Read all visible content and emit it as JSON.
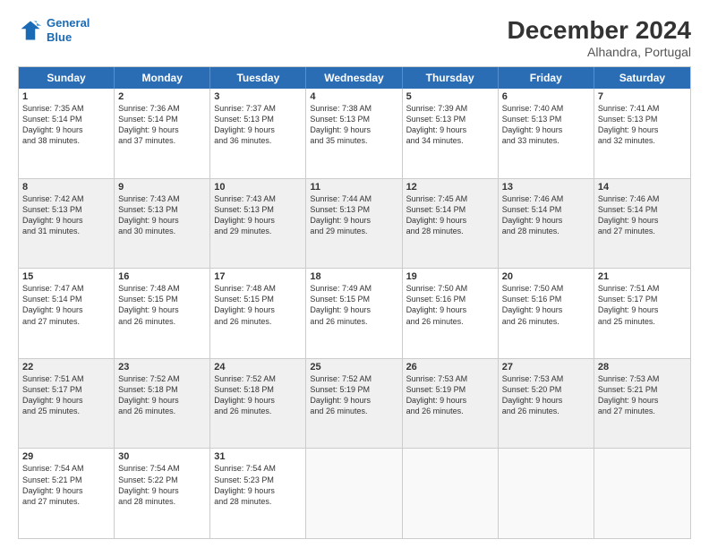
{
  "logo": {
    "line1": "General",
    "line2": "Blue"
  },
  "title": "December 2024",
  "subtitle": "Alhandra, Portugal",
  "header_days": [
    "Sunday",
    "Monday",
    "Tuesday",
    "Wednesday",
    "Thursday",
    "Friday",
    "Saturday"
  ],
  "rows": [
    [
      {
        "day": "1",
        "text": "Sunrise: 7:35 AM\nSunset: 5:14 PM\nDaylight: 9 hours\nand 38 minutes.",
        "empty": false,
        "shaded": false
      },
      {
        "day": "2",
        "text": "Sunrise: 7:36 AM\nSunset: 5:14 PM\nDaylight: 9 hours\nand 37 minutes.",
        "empty": false,
        "shaded": false
      },
      {
        "day": "3",
        "text": "Sunrise: 7:37 AM\nSunset: 5:13 PM\nDaylight: 9 hours\nand 36 minutes.",
        "empty": false,
        "shaded": false
      },
      {
        "day": "4",
        "text": "Sunrise: 7:38 AM\nSunset: 5:13 PM\nDaylight: 9 hours\nand 35 minutes.",
        "empty": false,
        "shaded": false
      },
      {
        "day": "5",
        "text": "Sunrise: 7:39 AM\nSunset: 5:13 PM\nDaylight: 9 hours\nand 34 minutes.",
        "empty": false,
        "shaded": false
      },
      {
        "day": "6",
        "text": "Sunrise: 7:40 AM\nSunset: 5:13 PM\nDaylight: 9 hours\nand 33 minutes.",
        "empty": false,
        "shaded": false
      },
      {
        "day": "7",
        "text": "Sunrise: 7:41 AM\nSunset: 5:13 PM\nDaylight: 9 hours\nand 32 minutes.",
        "empty": false,
        "shaded": false
      }
    ],
    [
      {
        "day": "8",
        "text": "Sunrise: 7:42 AM\nSunset: 5:13 PM\nDaylight: 9 hours\nand 31 minutes.",
        "empty": false,
        "shaded": true
      },
      {
        "day": "9",
        "text": "Sunrise: 7:43 AM\nSunset: 5:13 PM\nDaylight: 9 hours\nand 30 minutes.",
        "empty": false,
        "shaded": true
      },
      {
        "day": "10",
        "text": "Sunrise: 7:43 AM\nSunset: 5:13 PM\nDaylight: 9 hours\nand 29 minutes.",
        "empty": false,
        "shaded": true
      },
      {
        "day": "11",
        "text": "Sunrise: 7:44 AM\nSunset: 5:13 PM\nDaylight: 9 hours\nand 29 minutes.",
        "empty": false,
        "shaded": true
      },
      {
        "day": "12",
        "text": "Sunrise: 7:45 AM\nSunset: 5:14 PM\nDaylight: 9 hours\nand 28 minutes.",
        "empty": false,
        "shaded": true
      },
      {
        "day": "13",
        "text": "Sunrise: 7:46 AM\nSunset: 5:14 PM\nDaylight: 9 hours\nand 28 minutes.",
        "empty": false,
        "shaded": true
      },
      {
        "day": "14",
        "text": "Sunrise: 7:46 AM\nSunset: 5:14 PM\nDaylight: 9 hours\nand 27 minutes.",
        "empty": false,
        "shaded": true
      }
    ],
    [
      {
        "day": "15",
        "text": "Sunrise: 7:47 AM\nSunset: 5:14 PM\nDaylight: 9 hours\nand 27 minutes.",
        "empty": false,
        "shaded": false
      },
      {
        "day": "16",
        "text": "Sunrise: 7:48 AM\nSunset: 5:15 PM\nDaylight: 9 hours\nand 26 minutes.",
        "empty": false,
        "shaded": false
      },
      {
        "day": "17",
        "text": "Sunrise: 7:48 AM\nSunset: 5:15 PM\nDaylight: 9 hours\nand 26 minutes.",
        "empty": false,
        "shaded": false
      },
      {
        "day": "18",
        "text": "Sunrise: 7:49 AM\nSunset: 5:15 PM\nDaylight: 9 hours\nand 26 minutes.",
        "empty": false,
        "shaded": false
      },
      {
        "day": "19",
        "text": "Sunrise: 7:50 AM\nSunset: 5:16 PM\nDaylight: 9 hours\nand 26 minutes.",
        "empty": false,
        "shaded": false
      },
      {
        "day": "20",
        "text": "Sunrise: 7:50 AM\nSunset: 5:16 PM\nDaylight: 9 hours\nand 26 minutes.",
        "empty": false,
        "shaded": false
      },
      {
        "day": "21",
        "text": "Sunrise: 7:51 AM\nSunset: 5:17 PM\nDaylight: 9 hours\nand 25 minutes.",
        "empty": false,
        "shaded": false
      }
    ],
    [
      {
        "day": "22",
        "text": "Sunrise: 7:51 AM\nSunset: 5:17 PM\nDaylight: 9 hours\nand 25 minutes.",
        "empty": false,
        "shaded": true
      },
      {
        "day": "23",
        "text": "Sunrise: 7:52 AM\nSunset: 5:18 PM\nDaylight: 9 hours\nand 26 minutes.",
        "empty": false,
        "shaded": true
      },
      {
        "day": "24",
        "text": "Sunrise: 7:52 AM\nSunset: 5:18 PM\nDaylight: 9 hours\nand 26 minutes.",
        "empty": false,
        "shaded": true
      },
      {
        "day": "25",
        "text": "Sunrise: 7:52 AM\nSunset: 5:19 PM\nDaylight: 9 hours\nand 26 minutes.",
        "empty": false,
        "shaded": true
      },
      {
        "day": "26",
        "text": "Sunrise: 7:53 AM\nSunset: 5:19 PM\nDaylight: 9 hours\nand 26 minutes.",
        "empty": false,
        "shaded": true
      },
      {
        "day": "27",
        "text": "Sunrise: 7:53 AM\nSunset: 5:20 PM\nDaylight: 9 hours\nand 26 minutes.",
        "empty": false,
        "shaded": true
      },
      {
        "day": "28",
        "text": "Sunrise: 7:53 AM\nSunset: 5:21 PM\nDaylight: 9 hours\nand 27 minutes.",
        "empty": false,
        "shaded": true
      }
    ],
    [
      {
        "day": "29",
        "text": "Sunrise: 7:54 AM\nSunset: 5:21 PM\nDaylight: 9 hours\nand 27 minutes.",
        "empty": false,
        "shaded": false
      },
      {
        "day": "30",
        "text": "Sunrise: 7:54 AM\nSunset: 5:22 PM\nDaylight: 9 hours\nand 28 minutes.",
        "empty": false,
        "shaded": false
      },
      {
        "day": "31",
        "text": "Sunrise: 7:54 AM\nSunset: 5:23 PM\nDaylight: 9 hours\nand 28 minutes.",
        "empty": false,
        "shaded": false
      },
      {
        "day": "",
        "text": "",
        "empty": true,
        "shaded": false
      },
      {
        "day": "",
        "text": "",
        "empty": true,
        "shaded": false
      },
      {
        "day": "",
        "text": "",
        "empty": true,
        "shaded": false
      },
      {
        "day": "",
        "text": "",
        "empty": true,
        "shaded": false
      }
    ]
  ]
}
